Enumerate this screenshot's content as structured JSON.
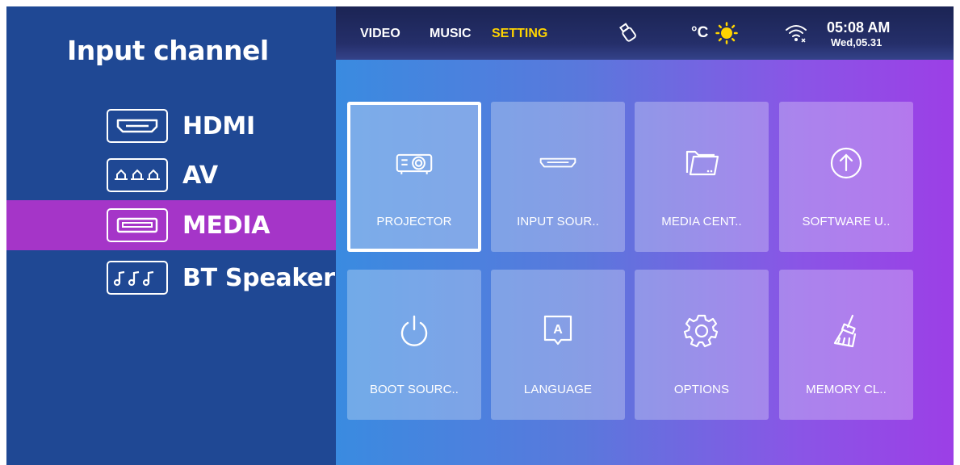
{
  "left_panel": {
    "title": "Input channel",
    "items": [
      {
        "label": "HDMI",
        "icon": "hdmi-port-icon",
        "selected": false
      },
      {
        "label": "AV",
        "icon": "av-port-icon",
        "selected": false
      },
      {
        "label": "MEDIA",
        "icon": "usb-port-icon",
        "selected": true
      },
      {
        "label": "BT Speaker",
        "icon": "music-notes-icon",
        "selected": false
      }
    ],
    "selected_color": "#a535c8",
    "background_color": "#1f4894"
  },
  "topbar": {
    "tabs": [
      {
        "label": "VIDEO",
        "active": false
      },
      {
        "label": "MUSIC",
        "active": false
      },
      {
        "label": "SETTING",
        "active": true
      }
    ],
    "active_tab_color": "#ffd400",
    "usb_icon": "usb-drive-icon",
    "temperature_unit": "°C",
    "weather_icon": "sun-icon",
    "wifi_icon": "wifi-disconnected-icon",
    "time": "05:08 AM",
    "date": "Wed,05.31"
  },
  "tiles": [
    {
      "label": "PROJECTOR",
      "icon": "projector-icon",
      "focused": true
    },
    {
      "label": "INPUT SOUR..",
      "icon": "input-source-icon",
      "focused": false
    },
    {
      "label": "MEDIA CENT..",
      "icon": "folder-icon",
      "focused": false
    },
    {
      "label": "SOFTWARE U..",
      "icon": "upgrade-arrow-icon",
      "focused": false
    },
    {
      "label": "BOOT SOURC..",
      "icon": "power-icon",
      "focused": false
    },
    {
      "label": "LANGUAGE",
      "icon": "language-icon",
      "focused": false
    },
    {
      "label": "OPTIONS",
      "icon": "gear-icon",
      "focused": false
    },
    {
      "label": "MEMORY CL..",
      "icon": "broom-icon",
      "focused": false
    }
  ]
}
